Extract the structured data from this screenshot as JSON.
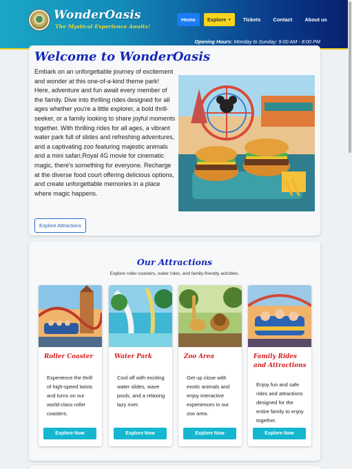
{
  "header": {
    "brand_title": "WonderOasis",
    "brand_tagline": "The Mystical Experience Awaits!",
    "nav": {
      "home": "Home",
      "explore": "Explore",
      "tickets": "Tickets",
      "contact": "Contact",
      "about": "About us"
    },
    "hours_label": "Opening Hours:",
    "hours_value": "Monday to Sunday: 9:00 AM - 8:00 PM"
  },
  "welcome": {
    "title": "Welcome to WonderOasis",
    "body": "Embark on an unforgettable journey of excitement and wonder at this one-of-a-kind theme park! Here, adventure and fun await every member of the family. Dive into thrilling rides designed for all ages whether you're a little explorer, a bold thrill-seeker, or a family looking to share joyful moments together. With thrilling rides for all ages, a vibrant water park full of slides and refreshing adventures, and a captivating zoo featuring majestic animals and a mini safari,Royal 4G movie for cinematic magic, there's something for everyone. Recharge at the diverse food court offering delicious options, and create unforgettable memories in a place where magic happens.",
    "button_label": "Explore Attractions"
  },
  "attractions": {
    "title": "Our Attractions",
    "subtitle": "Explore roller coasters, water rides, and family-friendly activities.",
    "cards": [
      {
        "title": "Roller Coaster",
        "text": "Experience the thrill of high-speed twists and turns on our world-class roller coasters.",
        "button": "Explore Now"
      },
      {
        "title": "Water Park",
        "text": "Cool off with exciting water slides, wave pools, and a relaxing lazy river.",
        "button": "Explore Now"
      },
      {
        "title": "Zoo Area",
        "text": "Get up close with exotic animals and enjoy interactive experiences in our zoo area.",
        "button": "Explore Now"
      },
      {
        "title": "Family Rides and Attractions",
        "text": "Enjoy fun and safe rides and attractions designed for the entire family to enjoy together.",
        "button": "Explore Now"
      }
    ]
  },
  "colors": {
    "accent_blue": "#1428b8",
    "accent_red": "#d21f1f",
    "button_cyan": "#15b6cf",
    "nav_yellow": "#f6d51c"
  }
}
